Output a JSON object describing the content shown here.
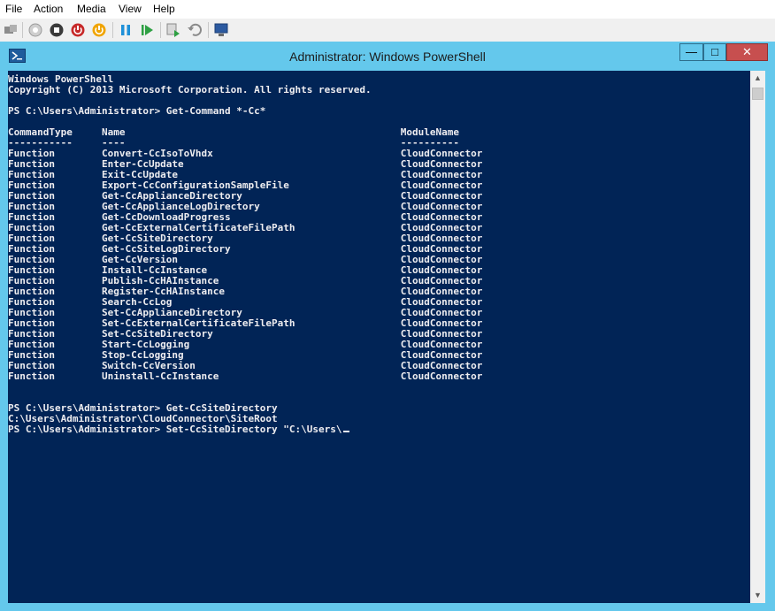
{
  "menu": [
    "File",
    "Action",
    "Media",
    "View",
    "Help"
  ],
  "toolbar_icons": [
    "ctrl-alt-del-icon",
    "start-icon",
    "turn-off-icon",
    "shut-down-icon",
    "save-icon",
    "pause-icon",
    "resume-icon",
    "checkpoint-icon",
    "revert-icon",
    "enhanced-session-icon"
  ],
  "window": {
    "title": "Administrator: Windows PowerShell",
    "minimize": "—",
    "maximize": "□",
    "close": "✕"
  },
  "console": {
    "lines": [
      "Windows PowerShell",
      "Copyright (C) 2013 Microsoft Corporation. All rights reserved.",
      "",
      "PS C:\\Users\\Administrator> Get-Command *-Cc*",
      "",
      "CommandType     Name                                               ModuleName",
      "-----------     ----                                               ----------",
      "Function        Convert-CcIsoToVhdx                                CloudConnector",
      "Function        Enter-CcUpdate                                     CloudConnector",
      "Function        Exit-CcUpdate                                      CloudConnector",
      "Function        Export-CcConfigurationSampleFile                   CloudConnector",
      "Function        Get-CcApplianceDirectory                           CloudConnector",
      "Function        Get-CcApplianceLogDirectory                        CloudConnector",
      "Function        Get-CcDownloadProgress                             CloudConnector",
      "Function        Get-CcExternalCertificateFilePath                  CloudConnector",
      "Function        Get-CcSiteDirectory                                CloudConnector",
      "Function        Get-CcSiteLogDirectory                             CloudConnector",
      "Function        Get-CcVersion                                      CloudConnector",
      "Function        Install-CcInstance                                 CloudConnector",
      "Function        Publish-CcHAInstance                               CloudConnector",
      "Function        Register-CcHAInstance                              CloudConnector",
      "Function        Search-CcLog                                       CloudConnector",
      "Function        Set-CcApplianceDirectory                           CloudConnector",
      "Function        Set-CcExternalCertificateFilePath                  CloudConnector",
      "Function        Set-CcSiteDirectory                                CloudConnector",
      "Function        Start-CcLogging                                    CloudConnector",
      "Function        Stop-CcLogging                                     CloudConnector",
      "Function        Switch-CcVersion                                   CloudConnector",
      "Function        Uninstall-CcInstance                               CloudConnector",
      "",
      "",
      "PS C:\\Users\\Administrator> Get-CcSiteDirectory",
      "C:\\Users\\Administrator\\CloudConnector\\SiteRoot"
    ],
    "current_input": "PS C:\\Users\\Administrator> Set-CcSiteDirectory \"C:\\Users\\"
  }
}
